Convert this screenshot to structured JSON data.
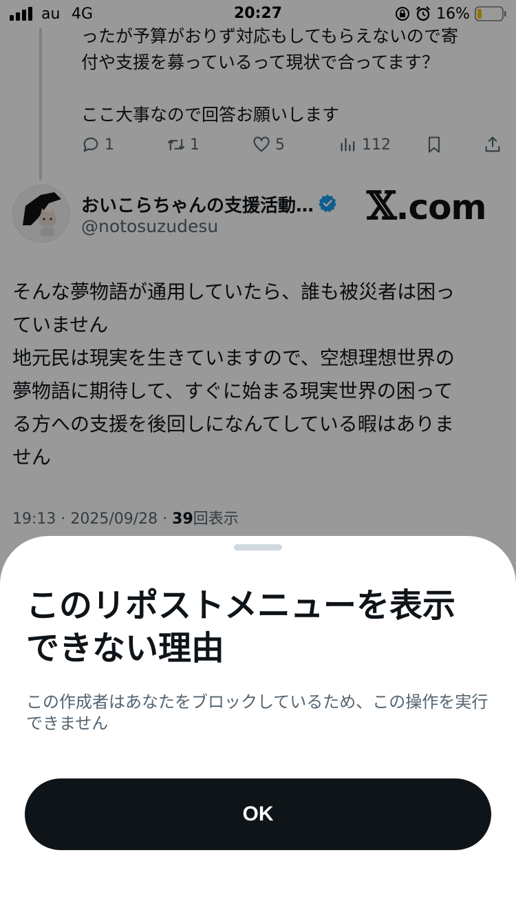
{
  "status_bar": {
    "carrier": "au",
    "network": "4G",
    "time": "20:27",
    "battery": "16%"
  },
  "thread": {
    "previous_tweet_text": "ったが予算がおりず対応もしてもらえないので寄\n付や支援を募っているって現状で合ってます？\n\nここ大事なので回答お願いします",
    "actions": {
      "reply_count": "1",
      "retweet_count": "1",
      "like_count": "5",
      "view_count": "112"
    }
  },
  "tweet": {
    "author_name": "おいこらちゃんの支援活動…",
    "handle": "@notosuzudesu",
    "watermark": ".com",
    "text": "そんな夢物語が通用していたら、誰も被災者は困っ\nていません\n地元民は現実を生きていますので、空想理想世界の\n夢物語に期待して、すぐに始まる現実世界の困って\nる方への支援を後回しになんてしている暇はありま\nせん",
    "time": "19:13 · 2025/09/28 · ",
    "views": "39",
    "views_suffix": "回表示"
  },
  "sheet": {
    "title": "このリポストメニューを表示できない理由",
    "description": "この作成者はあなたをブロックしているため、この操作を実行できません",
    "button_label": "OK"
  },
  "colors": {
    "text_primary": "#0f1419",
    "text_secondary": "#536471",
    "verified": "#1d9bf0",
    "button": "#0f1419",
    "battery_low": "#f5c400"
  }
}
